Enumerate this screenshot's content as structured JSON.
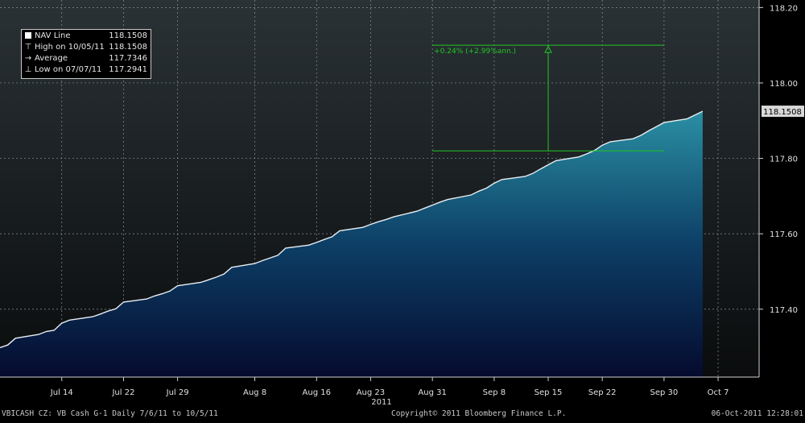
{
  "chart_data": {
    "type": "area",
    "year_label": "2011",
    "x_ticks": [
      "Jul 14",
      "Jul 22",
      "Jul 29",
      "Aug 8",
      "Aug 16",
      "Aug 23",
      "Aug 31",
      "Sep 8",
      "Sep 15",
      "Sep 22",
      "Sep 30",
      "Oct 7"
    ],
    "y_ticks": [
      "118.20",
      "118.00",
      "117.80",
      "117.60",
      "117.40"
    ],
    "ylim": [
      117.22,
      118.22
    ],
    "last_value_label": "118.1508",
    "series": [
      {
        "name": "NAV Line",
        "x": [
          "2011-07-06",
          "2011-07-07",
          "2011-07-08",
          "2011-07-11",
          "2011-07-12",
          "2011-07-13",
          "2011-07-14",
          "2011-07-15",
          "2011-07-18",
          "2011-07-19",
          "2011-07-20",
          "2011-07-21",
          "2011-07-22",
          "2011-07-25",
          "2011-07-26",
          "2011-07-27",
          "2011-07-28",
          "2011-07-29",
          "2011-08-01",
          "2011-08-02",
          "2011-08-03",
          "2011-08-04",
          "2011-08-05",
          "2011-08-08",
          "2011-08-09",
          "2011-08-10",
          "2011-08-11",
          "2011-08-12",
          "2011-08-15",
          "2011-08-16",
          "2011-08-17",
          "2011-08-18",
          "2011-08-19",
          "2011-08-22",
          "2011-08-23",
          "2011-08-24",
          "2011-08-25",
          "2011-08-26",
          "2011-08-29",
          "2011-08-30",
          "2011-08-31",
          "2011-09-01",
          "2011-09-02",
          "2011-09-05",
          "2011-09-06",
          "2011-09-07",
          "2011-09-08",
          "2011-09-09",
          "2011-09-12",
          "2011-09-13",
          "2011-09-14",
          "2011-09-15",
          "2011-09-16",
          "2011-09-19",
          "2011-09-20",
          "2011-09-21",
          "2011-09-22",
          "2011-09-23",
          "2011-09-26",
          "2011-09-27",
          "2011-09-28",
          "2011-09-29",
          "2011-09-30",
          "2011-10-03",
          "2011-10-04",
          "2011-10-05"
        ],
        "values": [
          117.298,
          117.305,
          117.323,
          117.333,
          117.341,
          117.344,
          117.363,
          117.371,
          117.38,
          117.387,
          117.395,
          117.401,
          117.419,
          117.427,
          117.435,
          117.441,
          117.448,
          117.462,
          117.471,
          117.478,
          117.485,
          117.493,
          117.511,
          117.521,
          117.529,
          117.536,
          117.543,
          117.562,
          117.57,
          117.577,
          117.585,
          117.592,
          117.608,
          117.617,
          117.625,
          117.632,
          117.638,
          117.645,
          117.66,
          117.668,
          117.676,
          117.684,
          117.691,
          117.703,
          117.713,
          117.721,
          117.734,
          117.744,
          117.752,
          117.76,
          117.772,
          117.783,
          117.794,
          117.804,
          117.812,
          117.821,
          117.835,
          117.844,
          117.852,
          117.861,
          117.873,
          117.884,
          117.895,
          117.905,
          117.915,
          117.925
        ]
      }
    ],
    "legend": [
      {
        "symbol": "■",
        "label": "NAV Line",
        "value": "118.1508"
      },
      {
        "symbol": "⊤",
        "label": "High on 10/05/11",
        "value": "118.1508"
      },
      {
        "symbol": "→",
        "label": "Average",
        "value": "117.7346"
      },
      {
        "symbol": "⊥",
        "label": "Low on 07/07/11",
        "value": "117.2941"
      }
    ],
    "annotation": {
      "text": "+0.24% (+2.99%ann.)",
      "from_date": "2011-08-31",
      "to_date": "2011-09-30",
      "from_value": 117.82,
      "to_value": 118.1
    }
  },
  "footer": {
    "left": "VBICASH CZ: VB Cash   G-1  Daily  7/6/11 to 10/5/11",
    "center": "Copyright© 2011 Bloomberg Finance L.P.",
    "right": "06-Oct-2011 12:28:01"
  },
  "colors": {
    "line": "#e8eef2",
    "annotation": "#22c522",
    "area_top": "#2a8fa3",
    "area_bottom": "#050a2e"
  }
}
